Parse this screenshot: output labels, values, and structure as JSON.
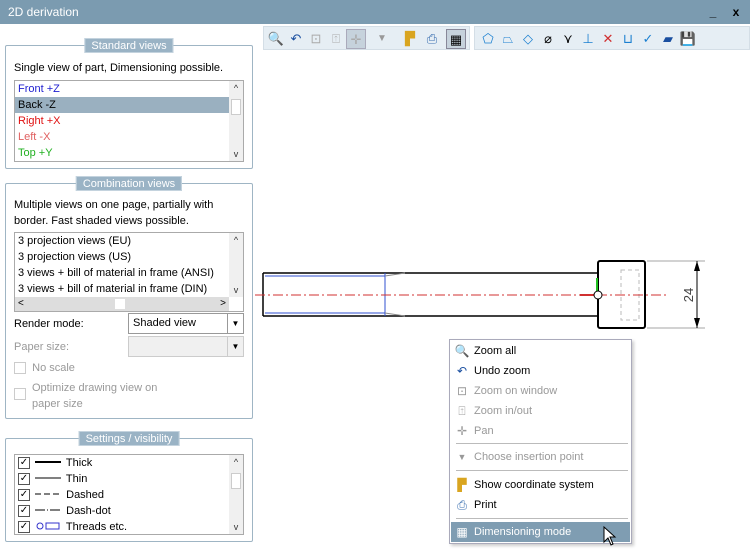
{
  "window": {
    "title": "2D derivation",
    "minimize": "_",
    "close": "x"
  },
  "standard_views": {
    "legend": "Standard views",
    "description": "Single view of part, Dimensioning possible.",
    "items": [
      {
        "label": "Front +Z",
        "color": "#2020d0"
      },
      {
        "label": "Back -Z",
        "color": "#000000",
        "selected": true
      },
      {
        "label": "Right +X",
        "color": "#e01010"
      },
      {
        "label": "Left -X",
        "color": "#e06060"
      },
      {
        "label": "Top +Y",
        "color": "#20b020"
      }
    ]
  },
  "combination_views": {
    "legend": "Combination views",
    "description_1": "Multiple views on one page, partially with",
    "description_2": "border. Fast shaded views possible.",
    "items": [
      "3 projection views (EU)",
      "3 projection views (US)",
      "3 views + bill of material in frame (ANSI)",
      "3 views + bill of material in frame (DIN)"
    ],
    "render_mode_label": "Render mode:",
    "render_mode_value": "Shaded view",
    "paper_size_label": "Paper size:",
    "paper_size_value": "",
    "no_scale": "No scale",
    "optimize_1": "Optimize drawing view on",
    "optimize_2": "paper size"
  },
  "settings": {
    "legend": "Settings / visibility",
    "items": [
      {
        "label": "Thick",
        "checked": true
      },
      {
        "label": "Thin",
        "checked": true
      },
      {
        "label": "Dashed",
        "checked": true
      },
      {
        "label": "Dash-dot",
        "checked": true
      },
      {
        "label": "Threads etc.",
        "checked": true
      }
    ]
  },
  "drawing": {
    "dimension": "24"
  },
  "context_menu": {
    "items": [
      {
        "label": "Zoom all",
        "icon": "zoom-all-icon",
        "enabled": true
      },
      {
        "label": "Undo zoom",
        "icon": "undo-icon",
        "enabled": true
      },
      {
        "label": "Zoom on window",
        "icon": "zoom-window-icon",
        "enabled": false
      },
      {
        "label": "Zoom in/out",
        "icon": "zoom-in-out-icon",
        "enabled": false
      },
      {
        "label": "Pan",
        "icon": "pan-icon",
        "enabled": false
      },
      {
        "label": "Choose insertion point",
        "icon": "triangle-down-icon",
        "enabled": false
      },
      {
        "label": "Show coordinate system",
        "icon": "coordinate-system-icon",
        "enabled": true
      },
      {
        "label": "Print",
        "icon": "printer-icon",
        "enabled": true
      },
      {
        "label": "Dimensioning mode",
        "icon": "dimensioning-icon",
        "enabled": true,
        "highlighted": true
      }
    ]
  },
  "colors": {
    "titlebar": "#7b9bb0",
    "selection": "#9ab0c0",
    "highlight": "#7f9db2"
  }
}
